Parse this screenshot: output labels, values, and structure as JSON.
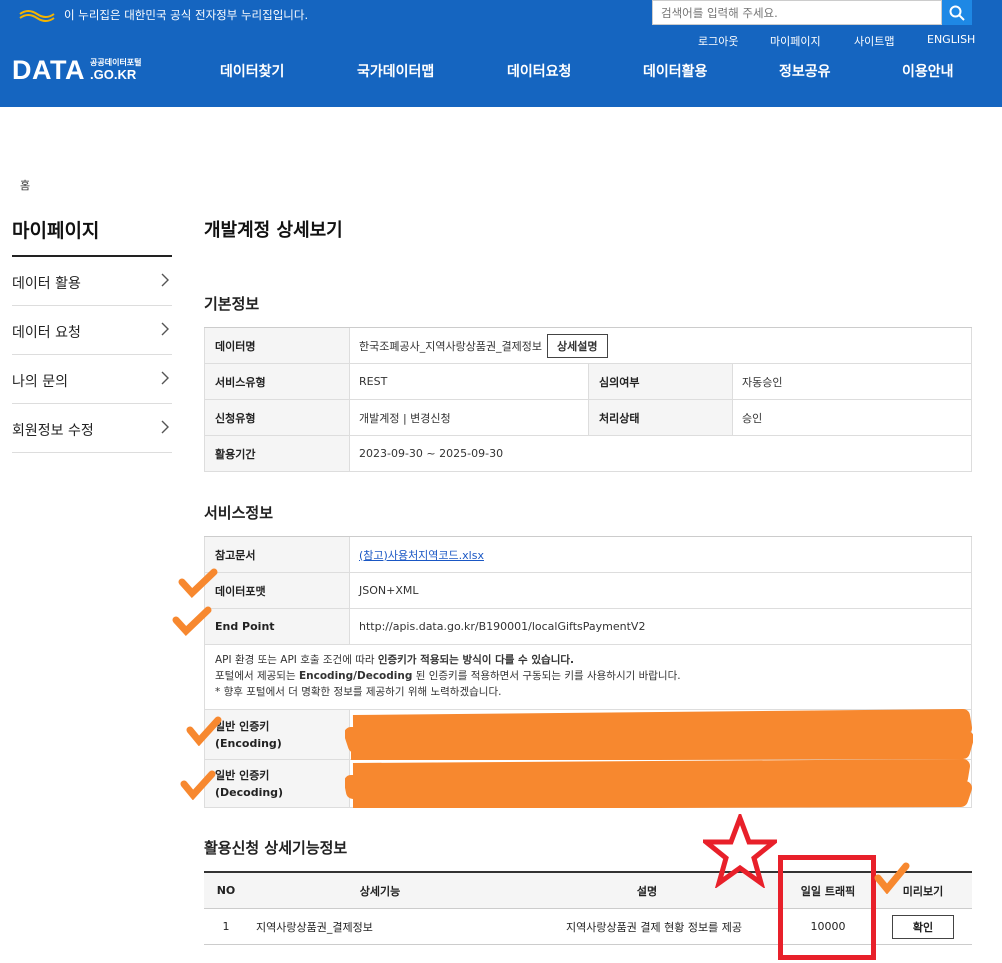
{
  "header": {
    "gov_banner": "이 누리집은 대한민국 공식 전자정부 누리집입니다.",
    "search_placeholder": "검색어를 입력해 주세요.",
    "util_links": [
      "로그아웃",
      "마이페이지",
      "사이트맵",
      "ENGLISH"
    ],
    "logo": {
      "main": "DATA",
      "sub_top": "공공데이터포털",
      "sub_bottom": ".GO.KR"
    },
    "nav": [
      "데이터찾기",
      "국가데이터맵",
      "데이터요청",
      "데이터활용",
      "정보공유",
      "이용안내"
    ],
    "brand_color": "#1565c0"
  },
  "breadcrumb": "홈",
  "sidebar": {
    "title": "마이페이지",
    "items": [
      "데이터 활용",
      "데이터 요청",
      "나의 문의",
      "회원정보 수정"
    ]
  },
  "page_title": "개발계정 상세보기",
  "basic_info": {
    "title": "기본정보",
    "data_name_label": "데이터명",
    "data_name_value": "한국조폐공사_지역사랑상품권_결제정보",
    "detail_button": "상세설명",
    "service_type_label": "서비스유형",
    "service_type_value": "REST",
    "review_label": "심의여부",
    "review_value": "자동승인",
    "apply_type_label": "신청유형",
    "apply_type_value": "개발계정 | 변경신청",
    "status_label": "처리상태",
    "status_value": "승인",
    "period_label": "활용기간",
    "period_value": "2023-09-30 ~ 2025-09-30"
  },
  "service_info": {
    "title": "서비스정보",
    "ref_doc_label": "참고문서",
    "ref_doc_value": "(참고)사용처지역코드.xlsx",
    "format_label": "데이터포맷",
    "format_value": "JSON+XML",
    "endpoint_label": "End Point",
    "endpoint_value": "http://apis.data.go.kr/B190001/localGiftsPaymentV2",
    "notice_line1_a": "API 환경 또는 API 호출 조건에 따라 ",
    "notice_line1_b": "인증키가 적용되는 방식이 다를 수 있습니다.",
    "notice_line2_a": "포털에서 제공되는 ",
    "notice_line2_b": "Encoding/Decoding",
    "notice_line2_c": " 된 인증키를 적용하면서 구동되는 키를 사용하시기 바랍니다.",
    "notice_line3": "* 향후 포털에서 더 명확한 정보를 제공하기 위해 노력하겠습니다.",
    "key_enc_label_1": "일반 인증키",
    "key_enc_label_2": "(Encoding)",
    "key_dec_label_1": "일반 인증키",
    "key_dec_label_2": "(Decoding)"
  },
  "feature_info": {
    "title": "활용신청 상세기능정보",
    "headers": [
      "NO",
      "상세기능",
      "설명",
      "일일 트래픽",
      "미리보기"
    ],
    "rows": [
      {
        "no": "1",
        "feature": "지역사랑상품권_결제정보",
        "desc": "지역사랑상품권 결제 현황 정보를 제공",
        "traffic": "10000",
        "preview": "확인"
      }
    ]
  },
  "annotation_colors": {
    "highlight": "#f7882f",
    "box": "#e8202a"
  }
}
